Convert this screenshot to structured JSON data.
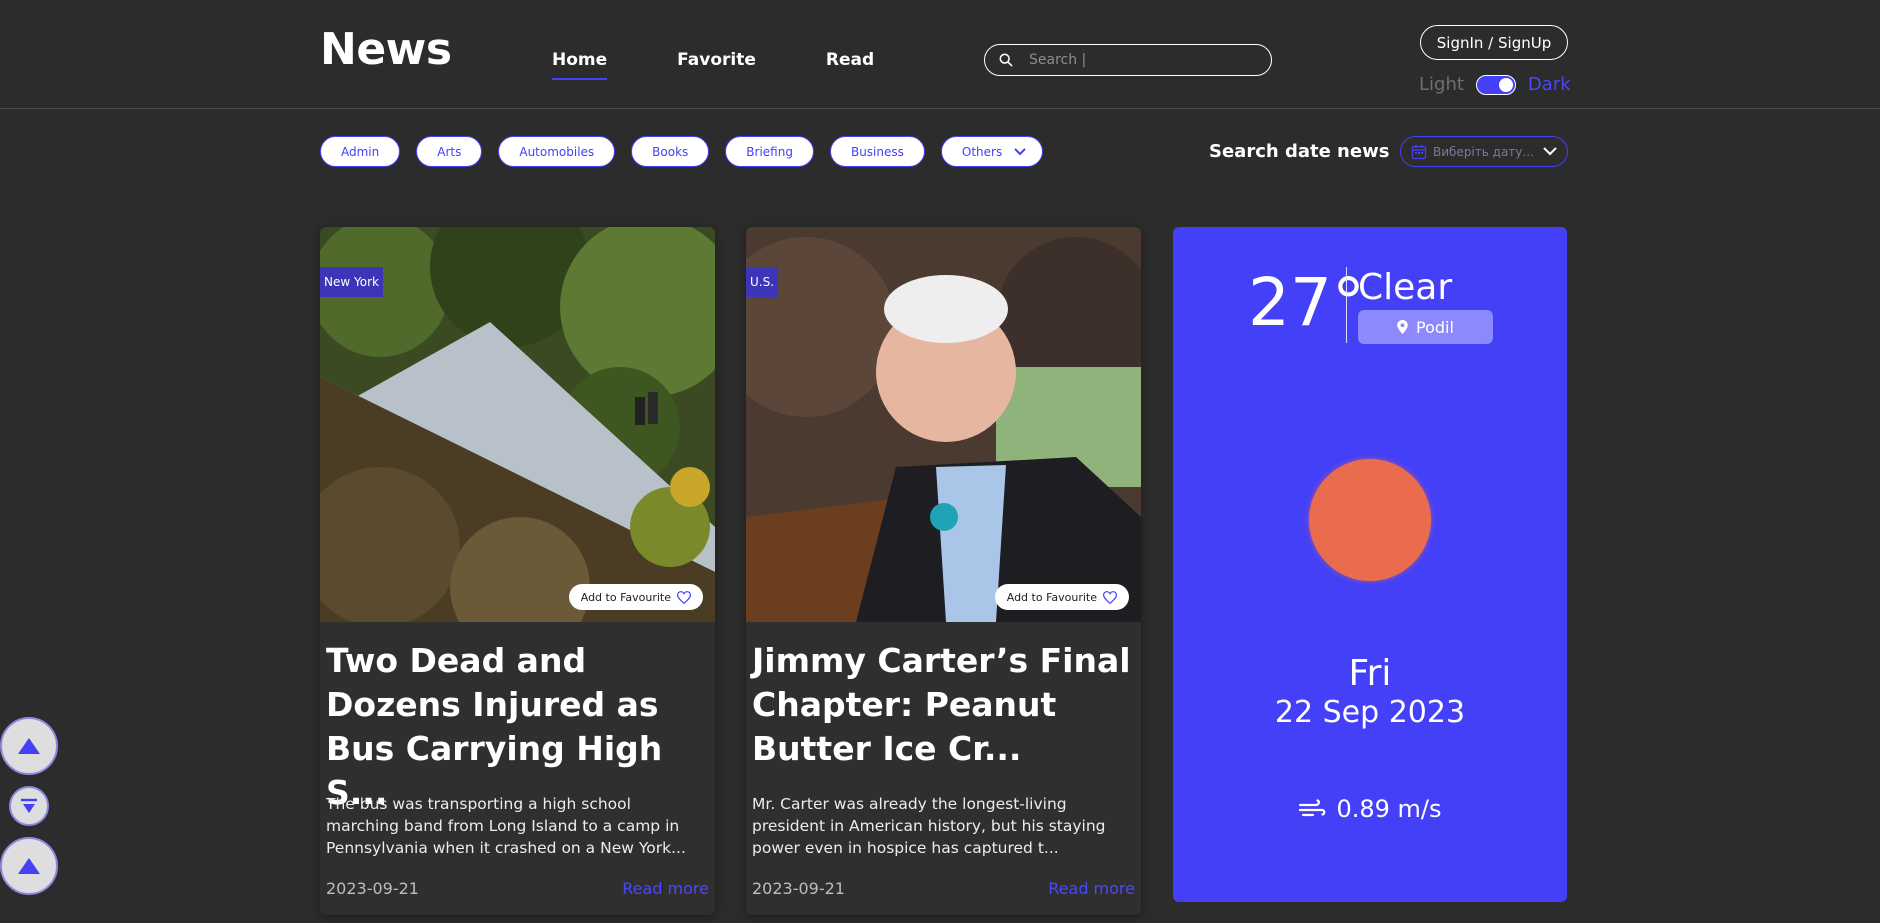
{
  "header": {
    "logo": "News",
    "nav": [
      {
        "label": "Home",
        "active": true
      },
      {
        "label": "Favorite",
        "active": false
      },
      {
        "label": "Read",
        "active": false
      }
    ],
    "search": {
      "placeholder": "Search |",
      "icon": "search-icon"
    },
    "signin_label": "SignIn / SignUp",
    "theme": {
      "light_label": "Light",
      "dark_label": "Dark",
      "dark_enabled": true
    }
  },
  "filters": {
    "categories": [
      "Admin",
      "Arts",
      "Automobiles",
      "Books",
      "Briefing",
      "Business"
    ],
    "others_label": "Others",
    "date_label": "Search date news",
    "date_placeholder": "Виберіть дату..."
  },
  "cards": [
    {
      "tag": "New York",
      "fav_label": "Add to Favourite",
      "title": "Two Dead and Dozens Injured as Bus Carrying High S...",
      "description": "The bus was transporting a high school marching band from Long Island to a camp in Pennsylvania when it crashed on a New York...",
      "date": "2023-09-21",
      "read_more": "Read more"
    },
    {
      "tag": "U.S.",
      "fav_label": "Add to Favourite",
      "title": "Jimmy Carter’s Final Chapter: Peanut Butter Ice Cr...",
      "description": "Mr. Carter was already the longest-living president in American history, but his staying power even in hospice has captured t...",
      "date": "2023-09-21",
      "read_more": "Read more"
    }
  ],
  "weather": {
    "temperature": "27°",
    "condition": "Clear",
    "location": "Podil",
    "day": "Fri",
    "date": "22 Sep 2023",
    "wind": "0.89 m/s",
    "sun_color": "#ea6c4f"
  },
  "colors": {
    "accent": "#4440f7",
    "background": "#2c2c2c"
  }
}
